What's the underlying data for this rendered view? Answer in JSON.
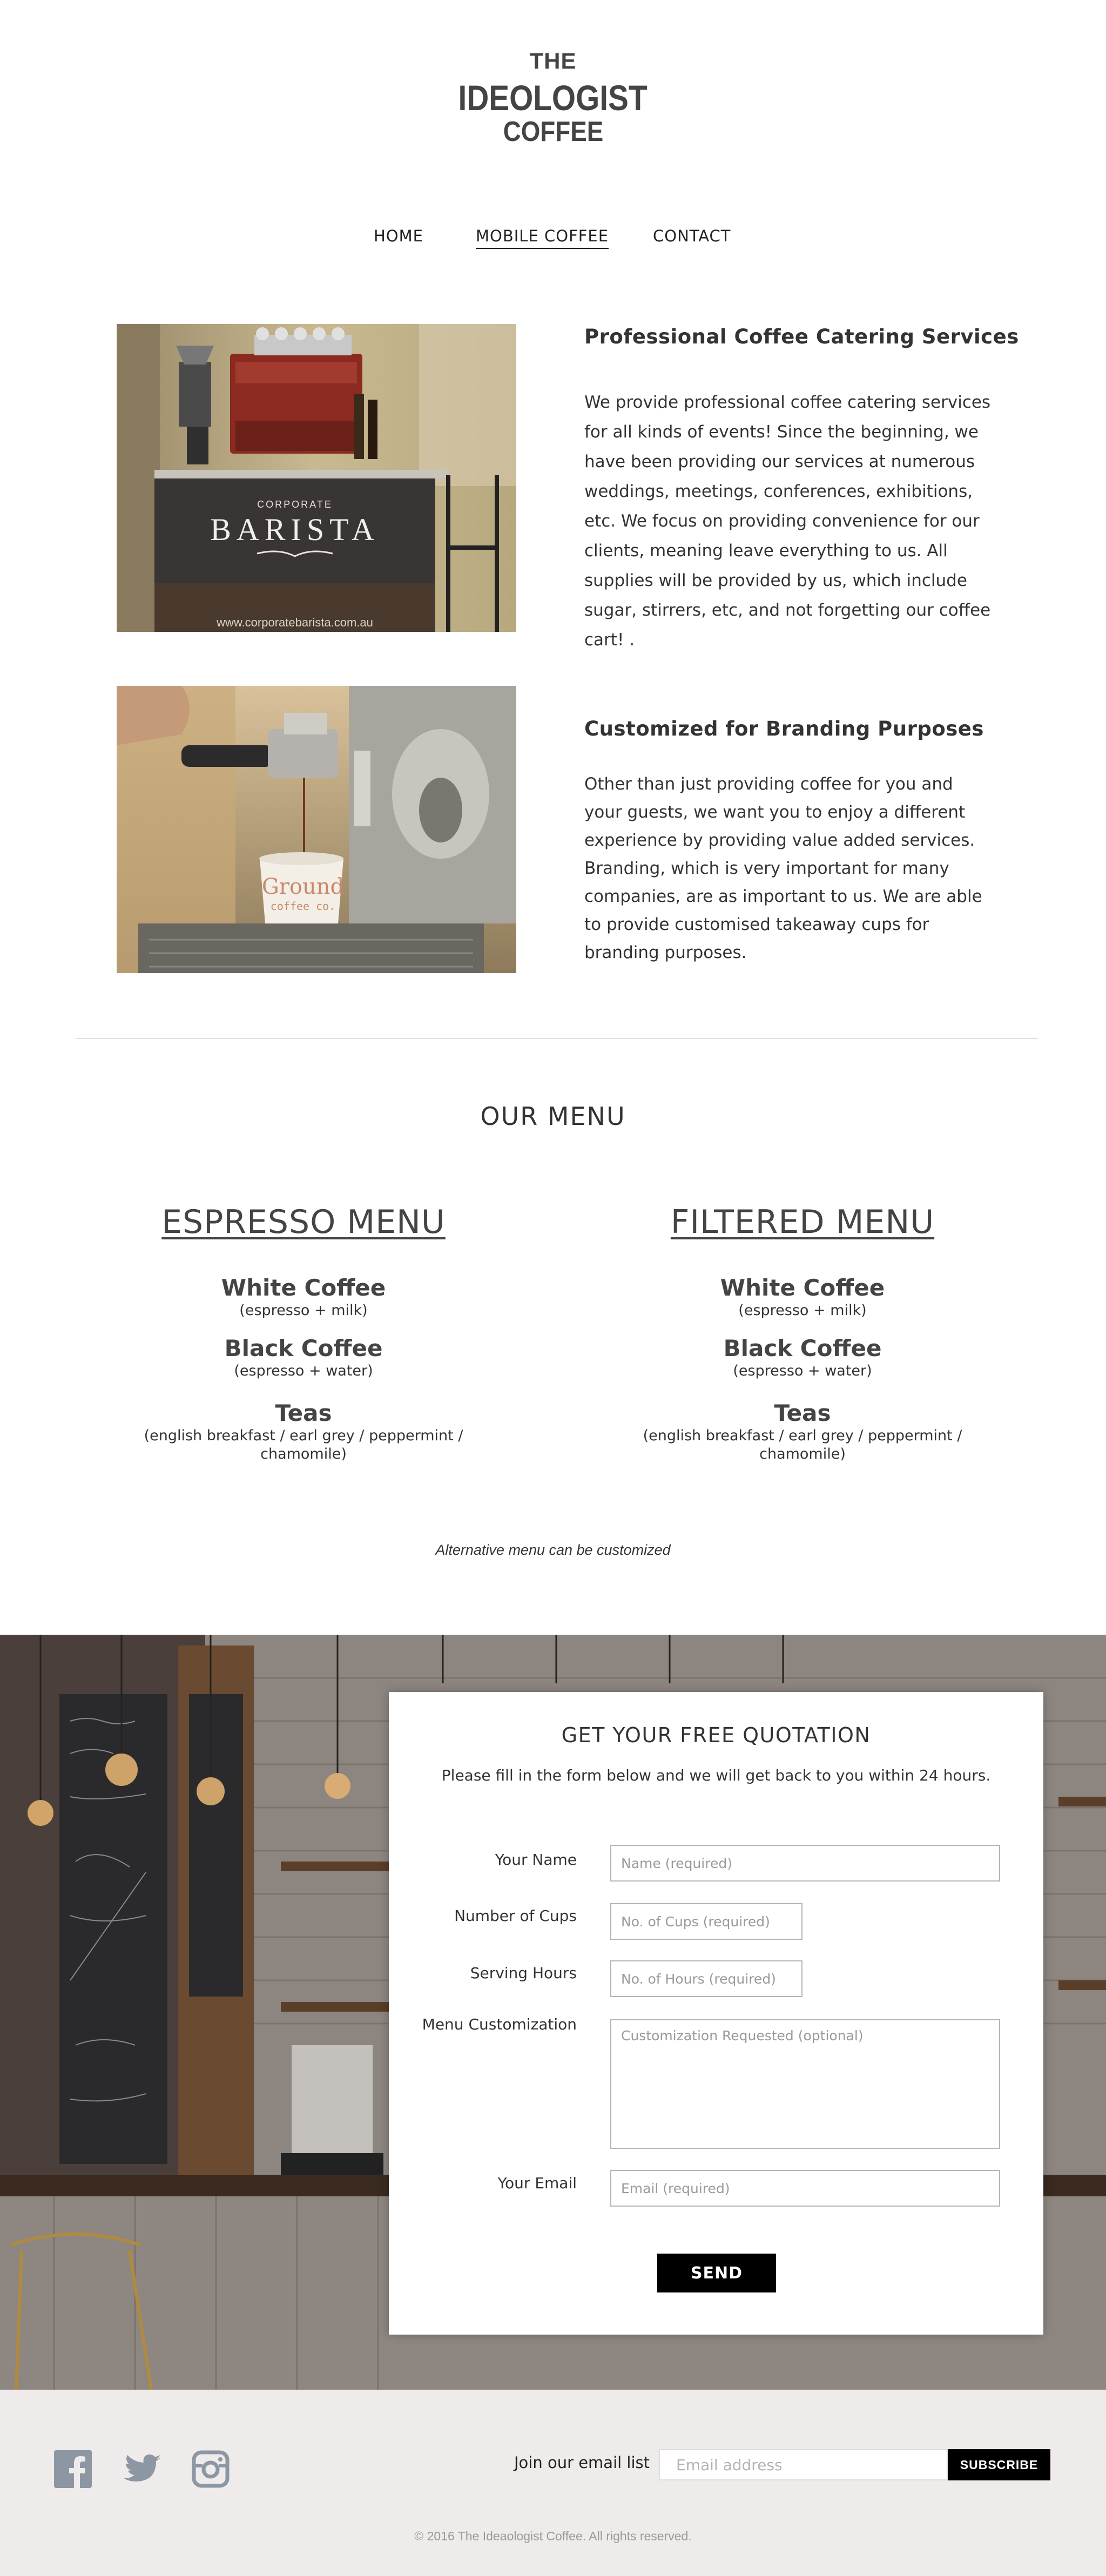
{
  "brand": {
    "logo_line1": "THE",
    "logo_line2": "IDEOLOGIST",
    "logo_line3": "COFFEE"
  },
  "nav": {
    "items": [
      {
        "label": "HOME"
      },
      {
        "label": "MOBILE COFFEE",
        "active": true
      },
      {
        "label": "CONTACT"
      }
    ]
  },
  "images": {
    "barista_cart": {
      "cart_brand_small": "CORPORATE",
      "cart_brand": "BARISTA",
      "cart_url": "www.corporatebarista.com.au"
    },
    "custom_cup": {
      "cup_brand": "Ground",
      "cup_sub": "coffee co."
    }
  },
  "services": [
    {
      "title": "Professional Coffee Catering Services",
      "text": "We provide professional coffee catering services for all kinds of events! Since the beginning, we have been providing our services at numerous weddings, meetings, conferences, exhibitions, etc. We focus on providing convenience for our clients, meaning leave everything to us. All supplies will be provided by us, which include sugar, stirrers, etc, and not forgetting our coffee cart! ."
    },
    {
      "title": "Customized for Branding Purposes",
      "text": "Other than just providing coffee for you and your guests, we want you to enjoy a different experience by providing value added services. Branding, which is very important for many companies, are as important to us. We are able to provide customised takeaway cups for branding purposes."
    }
  ],
  "menu": {
    "heading": "OUR MENU",
    "espresso": {
      "title": "ESPRESSO MENU",
      "items": [
        {
          "name": "White Coffee",
          "desc": "(espresso + milk)"
        },
        {
          "name": "Black Coffee",
          "desc": "(espresso + water)"
        },
        {
          "name": "Teas",
          "desc": "(english breakfast / earl grey / peppermint / chamomile)"
        }
      ]
    },
    "filtered": {
      "title": "FILTERED MENU",
      "items": [
        {
          "name": "White Coffee",
          "desc": "(espresso + milk)"
        },
        {
          "name": "Black Coffee",
          "desc": "(espresso + water)"
        },
        {
          "name": "Teas",
          "desc": "(english breakfast / earl grey / peppermint / chamomile)"
        }
      ]
    },
    "note": "Alternative menu can be customized"
  },
  "quotation": {
    "title": "GET YOUR FREE QUOTATION",
    "subtitle": "Please fill in the form below and we will get back to you within 24 hours.",
    "fields": {
      "name": {
        "label": "Your Name",
        "placeholder": "Name (required)",
        "value": ""
      },
      "cups": {
        "label": "Number of Cups",
        "placeholder": "No. of Cups (required)",
        "value": ""
      },
      "hours": {
        "label": "Serving Hours",
        "placeholder": "No. of Hours (required)",
        "value": ""
      },
      "custom": {
        "label": "Menu Customization",
        "placeholder": "Customization Requested (optional)",
        "value": ""
      },
      "email": {
        "label": "Your Email",
        "placeholder": "Email (required)",
        "value": ""
      }
    },
    "send_label": "SEND"
  },
  "footer": {
    "social": [
      {
        "icon": "facebook-icon"
      },
      {
        "icon": "twitter-icon"
      },
      {
        "icon": "instagram-icon"
      }
    ],
    "join_label": "Join our email list",
    "email_placeholder": "Email address",
    "subscribe_label": "SUBSCRIBE",
    "copyright": "© 2016 The Ideaologist Coffee. All rights reserved."
  },
  "colors": {
    "text": "#333333",
    "button": "#000000",
    "footer_bg": "#efebea",
    "social_icon": "#8d97a3"
  }
}
